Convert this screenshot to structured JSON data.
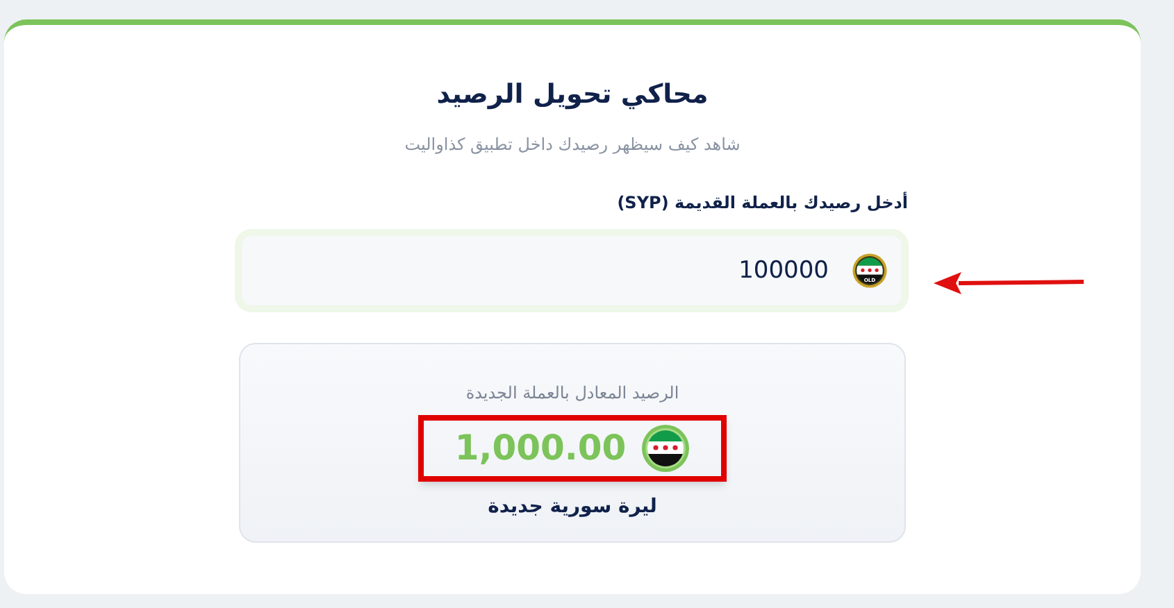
{
  "title": "محاكي تحويل الرصيد",
  "subtitle": "شاهد كيف سيظهر رصيدك داخل تطبيق كذاواليت",
  "input": {
    "label": "أدخل رصيدك بالعملة القديمة (SYP)",
    "value": "100000",
    "badge": "OLD"
  },
  "result": {
    "caption": "الرصيد المعادل بالعملة الجديدة",
    "amount": "1,000.00",
    "currency": "ليرة سورية جديدة",
    "highlighted": true
  },
  "arrow_annotation": true
}
